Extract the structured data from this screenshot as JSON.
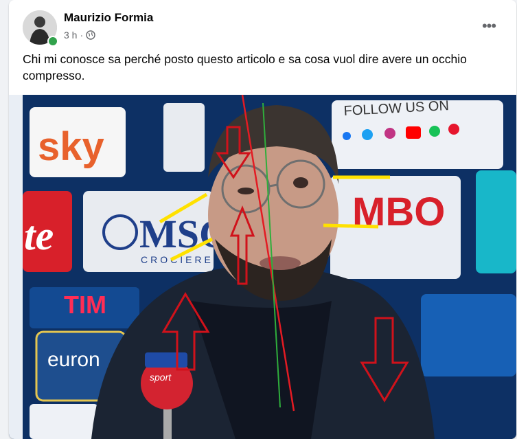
{
  "post": {
    "author": "Maurizio Formia",
    "time": "3 h",
    "separator": "·",
    "more_label": "•••",
    "text": "Chi mi conosce sa perché posto questo articolo e sa cosa vuol dire avere un occhio compresso."
  },
  "image": {
    "sponsor_texts": {
      "sky": "sky",
      "msc": "MSC",
      "crociere": "CROCIERE",
      "follow": "FOLLOW US ON",
      "mbo": "MBO",
      "tim": "TIM",
      "euro": "euron",
      "te": "te",
      "mic_label": "sport"
    },
    "annotation_colors": {
      "arrows": "#d0121b",
      "yellow_lines": "#ffe100",
      "green_line": "#2fae3c",
      "red_line": "#e31b23"
    }
  }
}
